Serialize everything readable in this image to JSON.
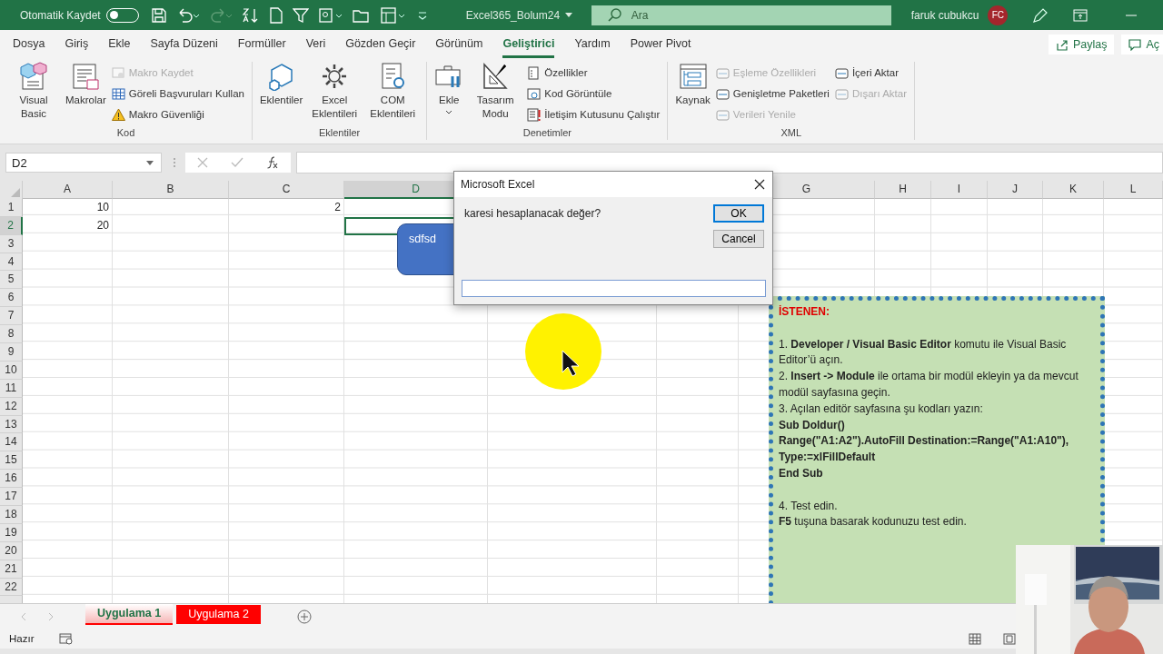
{
  "title_bar": {
    "autosave_label": "Otomatik Kaydet",
    "autosave_on": false,
    "file_name": "Excel365_Bolum24",
    "search": {
      "placeholder": "Ara"
    },
    "user_name": "faruk cubukcu",
    "avatar_initials": "FC"
  },
  "menu_tabs": [
    {
      "label": "Dosya",
      "selected": false
    },
    {
      "label": "Giriş",
      "selected": false
    },
    {
      "label": "Ekle",
      "selected": false
    },
    {
      "label": "Sayfa Düzeni",
      "selected": false
    },
    {
      "label": "Formüller",
      "selected": false
    },
    {
      "label": "Veri",
      "selected": false
    },
    {
      "label": "Gözden Geçir",
      "selected": false
    },
    {
      "label": "Görünüm",
      "selected": false
    },
    {
      "label": "Geliştirici",
      "selected": true
    },
    {
      "label": "Yardım",
      "selected": false
    },
    {
      "label": "Power Pivot",
      "selected": false
    }
  ],
  "share_button": "Paylaş",
  "comments_button": "Aç",
  "ribbon_groups": [
    {
      "title": "Kod",
      "large": [
        {
          "label": "Visual Basic",
          "disabled": false
        },
        {
          "label": "Makrolar",
          "disabled": false
        }
      ],
      "small": [
        {
          "label": "Makro Kaydet",
          "disabled": true
        },
        {
          "label": "Göreli Başvuruları Kullan",
          "disabled": false
        },
        {
          "label": "Makro Güvenliği",
          "disabled": false
        }
      ]
    },
    {
      "title": "Eklentiler",
      "large": [
        {
          "label": "Eklentiler",
          "disabled": false
        },
        {
          "label": "Excel Eklentileri",
          "disabled": false
        },
        {
          "label": "COM Eklentileri",
          "disabled": false
        }
      ]
    },
    {
      "title": "Denetimler",
      "large": [
        {
          "label": "Ekle",
          "disabled": false,
          "dropdown": true
        },
        {
          "label": "Tasarım Modu",
          "disabled": false
        }
      ],
      "small": [
        {
          "label": "Özellikler",
          "disabled": false
        },
        {
          "label": "Kod Görüntüle",
          "disabled": false
        },
        {
          "label": "İletişim Kutusunu Çalıştır",
          "disabled": false
        }
      ]
    },
    {
      "title": "XML",
      "large": [
        {
          "label": "Kaynak",
          "disabled": false
        }
      ],
      "small": [
        {
          "label": "Eşleme Özellikleri",
          "disabled": true
        },
        {
          "label": "Genişletme Paketleri",
          "disabled": false
        },
        {
          "label": "Verileri Yenile",
          "disabled": true
        }
      ],
      "small2": [
        {
          "label": "İçeri Aktar",
          "disabled": false
        },
        {
          "label": "Dışarı Aktar",
          "disabled": true
        }
      ]
    }
  ],
  "name_box": "D2",
  "columns": [
    {
      "label": "A",
      "selected": false
    },
    {
      "label": "B",
      "selected": false
    },
    {
      "label": "C",
      "selected": false
    },
    {
      "label": "D",
      "selected": true
    },
    null,
    null,
    {
      "label": "G",
      "selected": false
    },
    {
      "label": "H",
      "selected": false
    },
    {
      "label": "I",
      "selected": false
    },
    {
      "label": "J",
      "selected": false
    },
    {
      "label": "K",
      "selected": false
    },
    {
      "label": "L",
      "selected": false
    }
  ],
  "rows": [
    {
      "number": "1",
      "selected": false,
      "cells": [
        "10",
        null,
        "2"
      ]
    },
    {
      "number": "2",
      "selected": true,
      "cells": [
        "20"
      ]
    },
    {
      "number": "3",
      "selected": false
    },
    {
      "number": "4",
      "selected": false
    },
    {
      "number": "5",
      "selected": false
    },
    {
      "number": "6",
      "selected": false
    },
    {
      "number": "7",
      "selected": false
    },
    {
      "number": "8",
      "selected": false
    },
    {
      "number": "9",
      "selected": false
    },
    {
      "number": "10",
      "selected": false
    },
    {
      "number": "11",
      "selected": false
    },
    {
      "number": "12",
      "selected": false
    },
    {
      "number": "13",
      "selected": false
    },
    {
      "number": "14",
      "selected": false
    },
    {
      "number": "15",
      "selected": false
    },
    {
      "number": "16",
      "selected": false
    },
    {
      "number": "17",
      "selected": false
    },
    {
      "number": "18",
      "selected": false
    },
    {
      "number": "19",
      "selected": false
    },
    {
      "number": "20",
      "selected": false
    },
    {
      "number": "21",
      "selected": false
    },
    {
      "number": "22",
      "selected": false
    }
  ],
  "shape": {
    "text": "sdfsd"
  },
  "note_box": {
    "groups": [
      [
        {
          "kind": "heading",
          "text": "İSTENEN:"
        }
      ],
      [
        {
          "kind": "text",
          "text": "1. **Developer / Visual Basic Editor** komutu ile Visual Basic Editor’ü açın."
        },
        {
          "kind": "text",
          "text": "2. **Insert -> Module** ile ortama bir modül ekleyin ya da mevcut modül sayfasına geçin."
        },
        {
          "kind": "text",
          "text": "3. Açılan editör sayfasına şu kodları yazın:"
        },
        {
          "kind": "code",
          "text": "Sub Doldur()"
        },
        {
          "kind": "code",
          "text": "Range(\"A1:A2\").AutoFill Destination:=Range(\"A1:A10\"), Type:=xlFillDefault"
        },
        {
          "kind": "code",
          "text": "End Sub"
        }
      ],
      [
        {
          "kind": "text",
          "text": "4. Test edin."
        },
        {
          "kind": "text",
          "text": "**F5** tuşuna basarak kodunuzu test edin."
        }
      ]
    ]
  },
  "dialog": {
    "title": "Microsoft Excel",
    "message": "karesi hesaplanacak değer?",
    "ok": "OK",
    "cancel": "Cancel"
  },
  "sheet_tabs": [
    {
      "label": "Uygulama 1",
      "selected": true,
      "color": "#ff0000"
    },
    {
      "label": "Uygulama 2",
      "selected": false,
      "color": "#ff0000"
    }
  ],
  "status": "Hazır"
}
